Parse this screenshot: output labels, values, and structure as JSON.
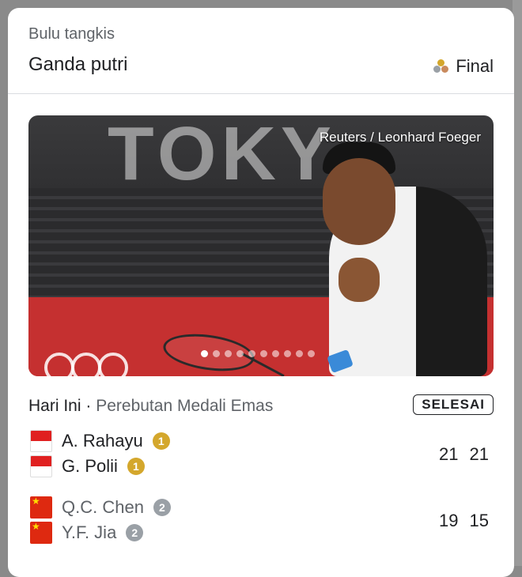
{
  "header": {
    "sport": "Bulu tangkis",
    "event": "Ganda putri",
    "status": "Final"
  },
  "colors": {
    "medal_gold": "#d4a72c",
    "medal_silver": "#9aa0a6",
    "medal_bronze": "#c98a5e",
    "flag_indonesia_red": "#e02020",
    "flag_china_red": "#de2910"
  },
  "photo": {
    "credit": "Reuters / Leonhard Foeger",
    "wall_text": "TOKY",
    "carousel_total": 10,
    "carousel_active": 1
  },
  "match": {
    "day": "Hari Ini",
    "separator": "·",
    "stage": "Perebutan Medali Emas",
    "state": "SELESAI"
  },
  "teams": [
    {
      "flag": "flag-indonesia",
      "players": [
        {
          "name": "A. Rahayu",
          "rank": "1"
        },
        {
          "name": "G. Polii",
          "rank": "1"
        }
      ],
      "scores": [
        "21",
        "21"
      ]
    },
    {
      "flag": "flag-china",
      "players": [
        {
          "name": "Q.C. Chen",
          "rank": "2"
        },
        {
          "name": "Y.F. Jia",
          "rank": "2"
        }
      ],
      "scores": [
        "19",
        "15"
      ]
    }
  ]
}
